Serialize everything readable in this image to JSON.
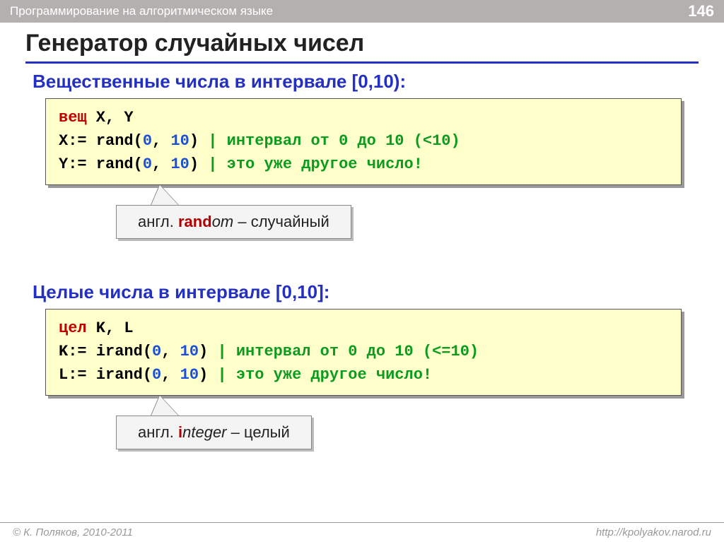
{
  "header": {
    "course": "Программирование на алгоритмическом языке",
    "page": "146"
  },
  "title": "Генератор случайных чисел",
  "section1": {
    "heading": "Вещественные числа в интервале [0,10):",
    "code": {
      "decl_kw": "вещ",
      "decl_vars": " X, Y",
      "l1_lhs": "X:= ",
      "l1_fn": "rand",
      "l1_args_open": "(",
      "l1_n0": "0",
      "l1_comma": ", ",
      "l1_n1": "10",
      "l1_args_close": ")",
      "l1_cmt": " | интервал от 0 до 10 (<10)",
      "l2_lhs": "Y:= ",
      "l2_fn": "rand",
      "l2_args_open": "(",
      "l2_n0": "0",
      "l2_comma": ", ",
      "l2_n1": "10",
      "l2_args_close": ")",
      "l2_cmt": " | это уже другое число!"
    },
    "callout_pre": "англ. ",
    "callout_hi": "rand",
    "callout_mid": "om",
    "callout_post": " – случайный"
  },
  "section2": {
    "heading": "Целые числа в интервале [0,10]:",
    "code": {
      "decl_kw": "цел",
      "decl_vars": " K, L",
      "l1_lhs": "K:= ",
      "l1_fn": "irand",
      "l1_args_open": "(",
      "l1_n0": "0",
      "l1_comma": ", ",
      "l1_n1": "10",
      "l1_args_close": ")",
      "l1_cmt": " | интервал от 0 до 10 (<=10)",
      "l2_lhs": "L:= ",
      "l2_fn": "irand",
      "l2_args_open": "(",
      "l2_n0": "0",
      "l2_comma": ", ",
      "l2_n1": "10",
      "l2_args_close": ")",
      "l2_cmt": " | это уже другое число!"
    },
    "callout_pre": "англ. ",
    "callout_hi": "i",
    "callout_mid": "nteger",
    "callout_post": " – целый"
  },
  "footer": {
    "left": "© К. Поляков, 2010-2011",
    "right": "http://kpolyakov.narod.ru"
  }
}
